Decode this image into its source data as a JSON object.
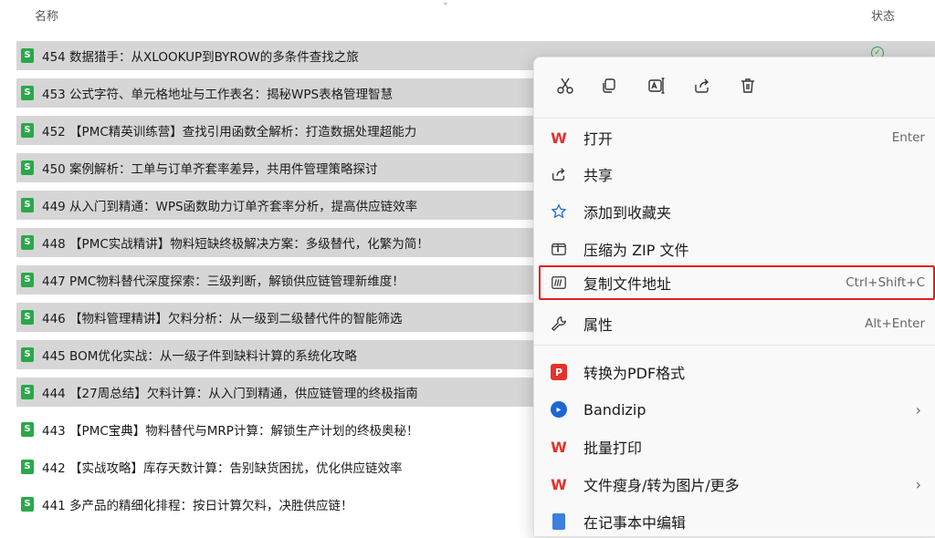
{
  "header": {
    "name_label": "名称",
    "status_label": "状态",
    "sort_indicator": "⌄"
  },
  "files": [
    {
      "name": "454 数据猎手：从XLOOKUP到BYROW的多条件查找之旅",
      "selected": true,
      "status": "✓"
    },
    {
      "name": "453 公式字符、单元格地址与工作表名：揭秘WPS表格管理智慧",
      "selected": true
    },
    {
      "name": "452 【PMC精英训练营】查找引用函数全解析：打造数据处理超能力",
      "selected": true
    },
    {
      "name": "450 案例解析：工单与订单齐套率差异，共用件管理策略探讨",
      "selected": true
    },
    {
      "name": "449 从入门到精通：WPS函数助力订单齐套率分析，提高供应链效率",
      "selected": true
    },
    {
      "name": "448 【PMC实战精讲】物料短缺终极解决方案：多级替代，化繁为简！",
      "selected": true
    },
    {
      "name": "447 PMC物料替代深度探索：三级判断，解锁供应链管理新维度！",
      "selected": true
    },
    {
      "name": "446 【物料管理精讲】欠料分析：从一级到二级替代件的智能筛选",
      "selected": true
    },
    {
      "name": "445 BOM优化实战：从一级子件到缺料计算的系统化攻略",
      "selected": true
    },
    {
      "name": "444 【27周总结】欠料计算：从入门到精通，供应链管理的终极指南",
      "selected": true
    },
    {
      "name": "443 【PMC宝典】物料替代与MRP计算：解锁生产计划的终极奥秘！",
      "selected": false
    },
    {
      "name": "442 【实战攻略】库存天数计算：告别缺货困扰，优化供应链效率",
      "selected": false
    },
    {
      "name": "441 多产品的精细化排程：按日计算欠料，决胜供应链！",
      "selected": false
    }
  ],
  "context_menu": {
    "quick_actions": [
      "cut",
      "copy",
      "rename",
      "share",
      "delete"
    ],
    "items": [
      {
        "label": "打开",
        "shortcut": "Enter",
        "icon": "wps-icon"
      },
      {
        "label": "共享",
        "shortcut": "",
        "icon": "share-icon"
      },
      {
        "label": "添加到收藏夹",
        "shortcut": "",
        "icon": "star-icon"
      },
      {
        "label": "压缩为 ZIP 文件",
        "shortcut": "",
        "icon": "zip-icon"
      },
      {
        "label": "复制文件地址",
        "shortcut": "Ctrl+Shift+C",
        "icon": "copy-path-icon",
        "highlighted": true
      },
      {
        "label": "属性",
        "shortcut": "Alt+Enter",
        "icon": "wrench-icon"
      },
      {
        "label": "转换为PDF格式",
        "shortcut": "",
        "icon": "pdf-icon",
        "pdf_glyph": "P"
      },
      {
        "label": "Bandizip",
        "shortcut": "",
        "icon": "bandizip-icon",
        "submenu": "›"
      },
      {
        "label": "批量打印",
        "shortcut": "",
        "icon": "wps-icon"
      },
      {
        "label": "文件瘦身/转为图片/更多",
        "shortcut": "",
        "icon": "wps-icon",
        "submenu": "›"
      },
      {
        "label": "在记事本中编辑",
        "shortcut": "",
        "icon": "notepad-icon"
      }
    ]
  },
  "colors": {
    "selected_row": "#d6d6d6",
    "highlight_border": "#e02020",
    "excel_green": "#2aa84a",
    "wps_red": "#e5312c"
  }
}
